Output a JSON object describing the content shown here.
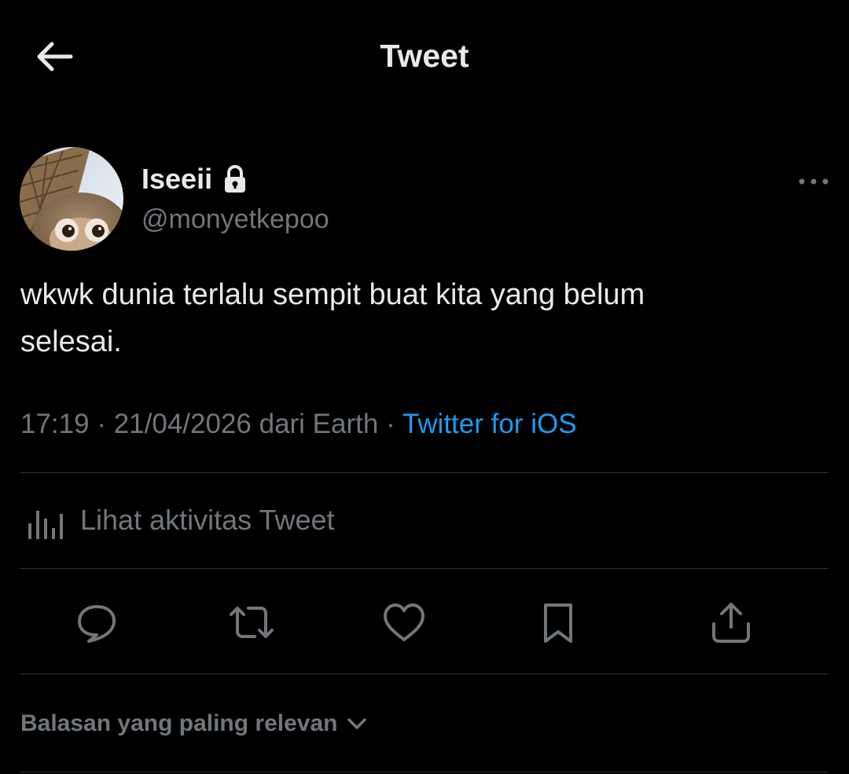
{
  "header": {
    "title": "Tweet"
  },
  "author": {
    "display_name": "Iseeii",
    "handle": "@monyetkepoo"
  },
  "tweet": {
    "text": "wkwk dunia terlalu sempit buat kita yang belum\nselesai."
  },
  "meta": {
    "time": "17:19",
    "sep1": " · ",
    "date_location": "21/04/2026 dari Earth",
    "sep2": " · ",
    "source": "Twitter for iOS"
  },
  "activity": {
    "label": "Lihat aktivitas Tweet"
  },
  "replies": {
    "sort_label": "Balasan yang paling relevan"
  },
  "icons": {
    "back": "arrow-left-icon",
    "lock": "lock-icon",
    "more": "more-dots-icon",
    "analytics": "bar-chart-icon",
    "reply": "speech-bubble-icon",
    "retweet": "retweet-icon",
    "like": "heart-icon",
    "bookmark": "bookmark-icon",
    "share": "share-icon",
    "chevron": "chevron-down-icon"
  },
  "colors": {
    "background": "#000000",
    "text": "#e7e9ea",
    "muted": "#71767b",
    "link": "#1d9bf0",
    "divider": "#2f3336"
  }
}
